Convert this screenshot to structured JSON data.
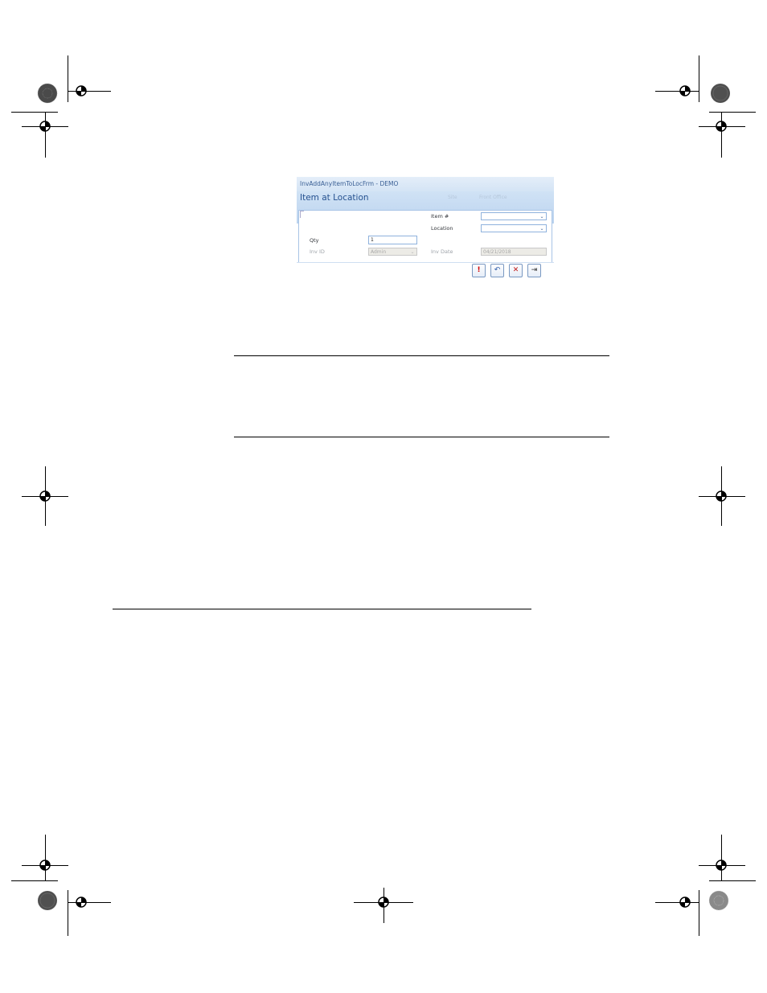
{
  "window": {
    "title": "InvAddAnyItemToLocFrm - DEMO",
    "header_title": "Item at Location",
    "site_label": "Site",
    "site_value": "Front Office"
  },
  "form": {
    "item_label": "Item #",
    "item_value": "",
    "location_label": "Location",
    "location_value": "",
    "qty_label": "Qty",
    "qty_value": "1",
    "inv_id_label": "Inv ID",
    "inv_id_value": "Admin",
    "inv_date_label": "Inv Date",
    "inv_date_value": "04/21/2018"
  },
  "toolbar": {
    "save_glyph": "!",
    "undo_glyph": "↶",
    "delete_glyph": "✕",
    "close_glyph": "⇥"
  },
  "icons": {
    "save": "exclamation-icon",
    "undo": "undo-icon",
    "delete": "delete-x-icon",
    "close": "exit-door-icon"
  },
  "colors": {
    "header_blue": "#bcd4ef",
    "title_text": "#25518f",
    "delete_red": "#c01818",
    "save_red": "#d10000"
  }
}
